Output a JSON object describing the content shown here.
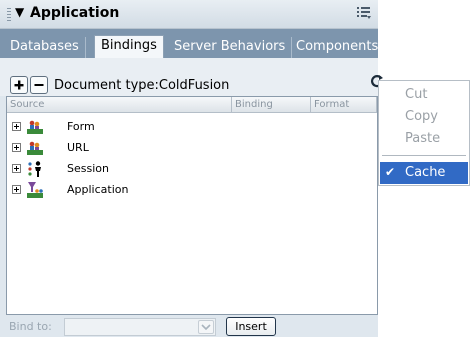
{
  "panel": {
    "title": "Application",
    "tabs": [
      {
        "label": "Databases",
        "active": false
      },
      {
        "label": "Bindings",
        "active": true
      },
      {
        "label": "Server Behaviors",
        "active": false
      },
      {
        "label": "Components",
        "active": false
      }
    ]
  },
  "toolbar": {
    "add_icon": "plus-icon",
    "remove_icon": "minus-icon",
    "document_type": "Document type:ColdFusion",
    "refresh_icon": "refresh-icon"
  },
  "columns": [
    "Source",
    "Binding",
    "Format"
  ],
  "tree": [
    {
      "label": "Form",
      "icon": "form-icon"
    },
    {
      "label": "URL",
      "icon": "url-icon"
    },
    {
      "label": "Session",
      "icon": "session-icon"
    },
    {
      "label": "Application",
      "icon": "application-icon"
    }
  ],
  "bind": {
    "label": "Bind to:",
    "value": "",
    "insert_label": "Insert"
  },
  "context_menu": {
    "items": [
      {
        "label": "Cut",
        "enabled": false
      },
      {
        "label": "Copy",
        "enabled": false
      },
      {
        "label": "Paste",
        "enabled": false
      }
    ],
    "checked_item": {
      "label": "Cache",
      "checked": true
    }
  },
  "colors": {
    "tabbar": "#7d95ad",
    "panel": "#dfe7ee",
    "menu_highlight": "#316ac5"
  }
}
